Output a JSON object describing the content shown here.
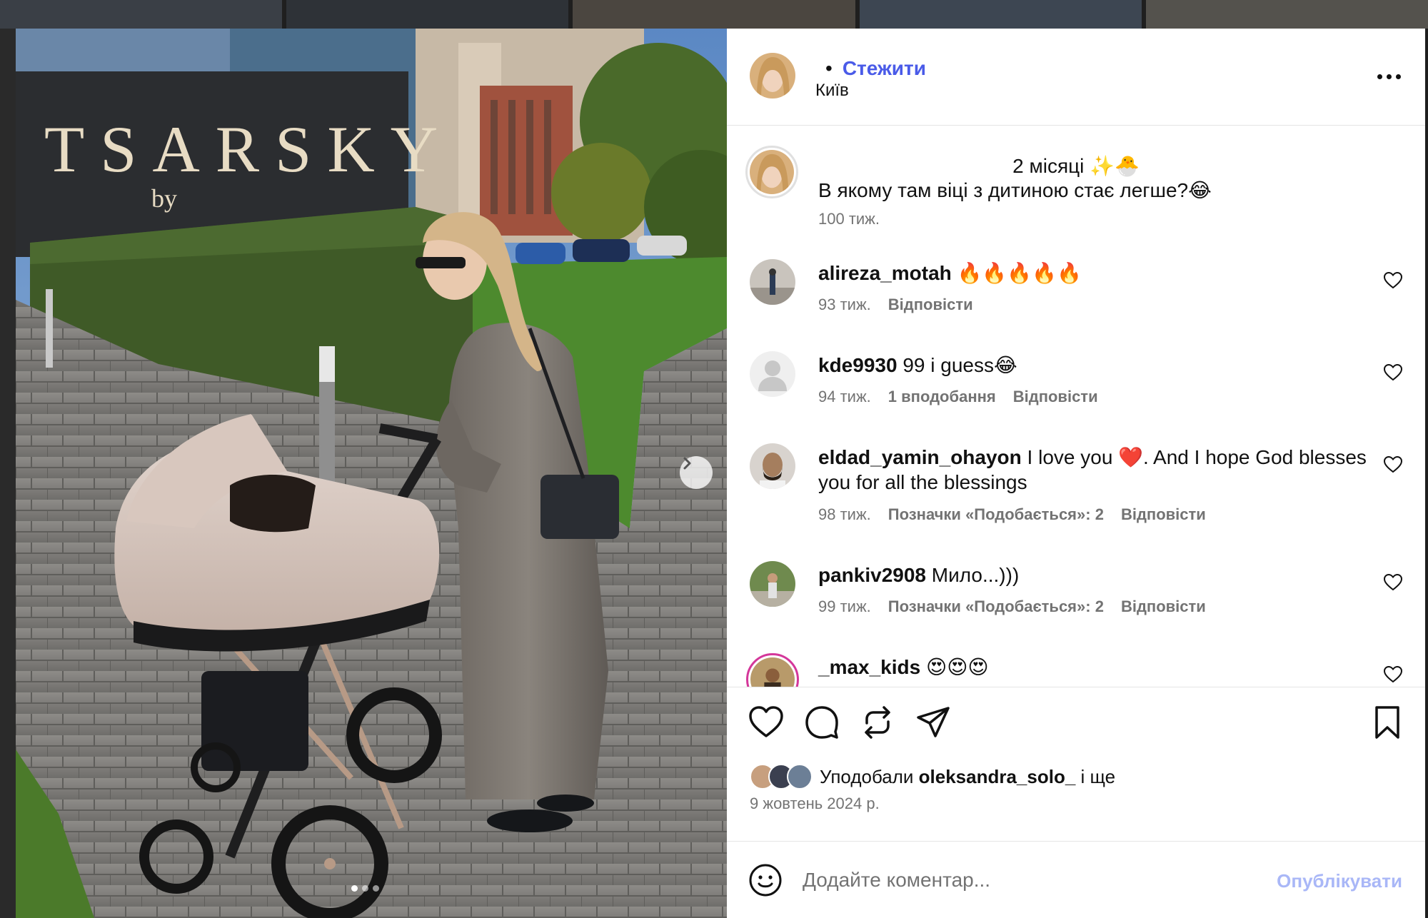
{
  "header": {
    "username": "",
    "separator": "•",
    "follow_label": "Стежити",
    "location": "Київ"
  },
  "caption": {
    "line1": "2 місяці ✨🐣",
    "line2": "В якому там віці з дитиною стає легше?😂",
    "time": "100 тиж."
  },
  "comments": [
    {
      "user": "alireza_motah",
      "text": "🔥🔥🔥🔥🔥",
      "time": "93 тиж.",
      "likes": "",
      "reply": "Відповісти"
    },
    {
      "user": "kde9930",
      "text": "99 i guess😂",
      "time": "94 тиж.",
      "likes": "1 вподобання",
      "reply": "Відповісти"
    },
    {
      "user": "eldad_yamin_ohayon",
      "text": "I love you ❤️. And I hope God blesses you for all the blessings",
      "time": "98 тиж.",
      "likes": "Позначки «Подобається»: 2",
      "reply": "Відповісти"
    },
    {
      "user": "pankiv2908",
      "text": "Мило...)))",
      "time": "99 тиж.",
      "likes": "Позначки «Подобається»: 2",
      "reply": "Відповісти"
    },
    {
      "user": "_max_kids",
      "text": "😍😍😍",
      "time": "",
      "likes": "",
      "reply": ""
    }
  ],
  "likes": {
    "prefix": "Уподобали",
    "user": "oleksandra_solo_",
    "suffix": "і ще"
  },
  "post_date": "9 жовтень 2024 р.",
  "comment_bar": {
    "placeholder": "Додайте коментар...",
    "post_label": "Опублікувати"
  },
  "photo": {
    "sign_text": "TSARSKY",
    "sign_sub": "by"
  },
  "colors": {
    "accent": "#4a5be8",
    "post_disabled": "#a9b7f7",
    "muted": "#737373"
  }
}
